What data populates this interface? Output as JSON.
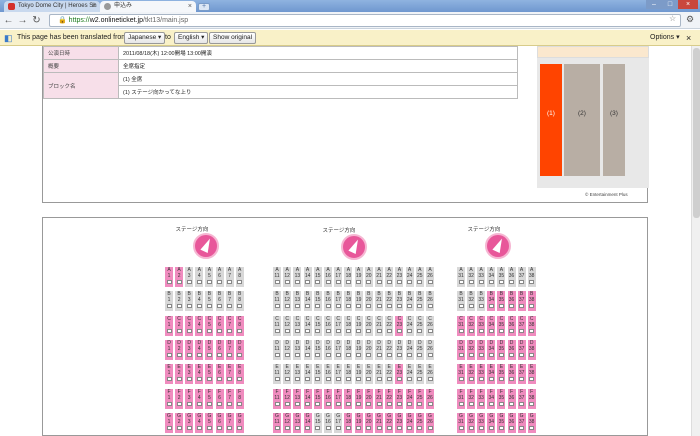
{
  "browser": {
    "tabs": [
      {
        "title": "Tokyo Dome City | Heroes Sh"
      },
      {
        "title": "申込み"
      }
    ],
    "new_tab_symbol": "+",
    "window_buttons": [
      "–",
      "□",
      "×"
    ],
    "url_scheme": "https://",
    "url_host": "w2.onlineticket.jp",
    "url_path": "/tkt13/main.jsp"
  },
  "translate_bar": {
    "message": "This page has been translated from",
    "from_lang": "Japanese",
    "to_word": "to",
    "to_lang": "English",
    "show_original": "Show original",
    "options": "Options"
  },
  "info_table": [
    {
      "label": "公演日時",
      "value": "2011/08/18(木) 12:00開場 13:00開演"
    },
    {
      "label": "概要",
      "value": "全席指定"
    },
    {
      "label": "ブロック名",
      "value": "(1) 全席"
    },
    {
      "label": "",
      "value": "(1) ステージ向かってな上り"
    }
  ],
  "venue_map": {
    "blocks": [
      "(1)",
      "(2)",
      "(3)"
    ],
    "copyright": "© Entertainment Plus",
    "colors": {
      "selected_block": "#ff4400",
      "block": "#b8aea4"
    }
  },
  "seating": {
    "stage_direction_label": "ステージ方向",
    "colors": {
      "available": "#f08cbf",
      "unavailable": "#d8d8d8"
    },
    "sections": [
      {
        "rows": [
          "A",
          "B",
          "C",
          "D",
          "E",
          "F",
          "G"
        ],
        "seat_numbers": [
          "1",
          "2",
          "3",
          "4",
          "5",
          "6",
          "7",
          "8"
        ],
        "available": [
          [
            1,
            1,
            0,
            0,
            0,
            0,
            0,
            0
          ],
          [
            0,
            0,
            0,
            0,
            0,
            0,
            0,
            0
          ],
          [
            1,
            1,
            1,
            1,
            1,
            1,
            1,
            1
          ],
          [
            1,
            1,
            1,
            1,
            1,
            1,
            1,
            1
          ],
          [
            1,
            1,
            1,
            1,
            1,
            1,
            1,
            1
          ],
          [
            1,
            1,
            1,
            1,
            1,
            1,
            1,
            1
          ],
          [
            1,
            1,
            1,
            1,
            1,
            1,
            1,
            1
          ]
        ]
      },
      {
        "rows": [
          "A",
          "B",
          "C",
          "D",
          "E",
          "F",
          "G"
        ],
        "seat_numbers": [
          "11",
          "12",
          "13",
          "14",
          "15",
          "16",
          "17",
          "18",
          "19",
          "20",
          "21",
          "22",
          "23",
          "24",
          "25",
          "26"
        ],
        "available": [
          [
            0,
            0,
            0,
            0,
            0,
            0,
            0,
            0,
            0,
            0,
            0,
            0,
            0,
            0,
            0,
            0
          ],
          [
            0,
            0,
            0,
            0,
            0,
            0,
            0,
            0,
            0,
            0,
            0,
            0,
            0,
            0,
            0,
            0
          ],
          [
            0,
            0,
            0,
            0,
            0,
            0,
            0,
            0,
            0,
            0,
            0,
            0,
            1,
            0,
            0,
            0
          ],
          [
            0,
            0,
            0,
            0,
            0,
            0,
            0,
            0,
            0,
            0,
            0,
            0,
            0,
            0,
            0,
            0
          ],
          [
            0,
            0,
            0,
            0,
            0,
            0,
            0,
            0,
            0,
            0,
            0,
            0,
            1,
            0,
            0,
            0
          ],
          [
            1,
            1,
            1,
            1,
            1,
            1,
            1,
            1,
            1,
            1,
            1,
            1,
            1,
            1,
            1,
            1
          ],
          [
            1,
            1,
            1,
            1,
            0,
            0,
            0,
            1,
            1,
            1,
            1,
            1,
            1,
            1,
            1,
            1
          ]
        ]
      },
      {
        "rows": [
          "A",
          "B",
          "C",
          "D",
          "E",
          "F",
          "G"
        ],
        "seat_numbers": [
          "31",
          "32",
          "33",
          "34",
          "35",
          "36",
          "37",
          "38"
        ],
        "available": [
          [
            0,
            0,
            0,
            0,
            0,
            0,
            0,
            0
          ],
          [
            0,
            0,
            0,
            1,
            1,
            1,
            1,
            1
          ],
          [
            1,
            1,
            1,
            1,
            1,
            1,
            1,
            1
          ],
          [
            1,
            1,
            1,
            1,
            1,
            1,
            1,
            1
          ],
          [
            1,
            1,
            1,
            1,
            1,
            1,
            1,
            1
          ],
          [
            1,
            1,
            1,
            1,
            1,
            1,
            1,
            1
          ],
          [
            1,
            1,
            1,
            1,
            1,
            1,
            1,
            1
          ]
        ]
      }
    ]
  }
}
